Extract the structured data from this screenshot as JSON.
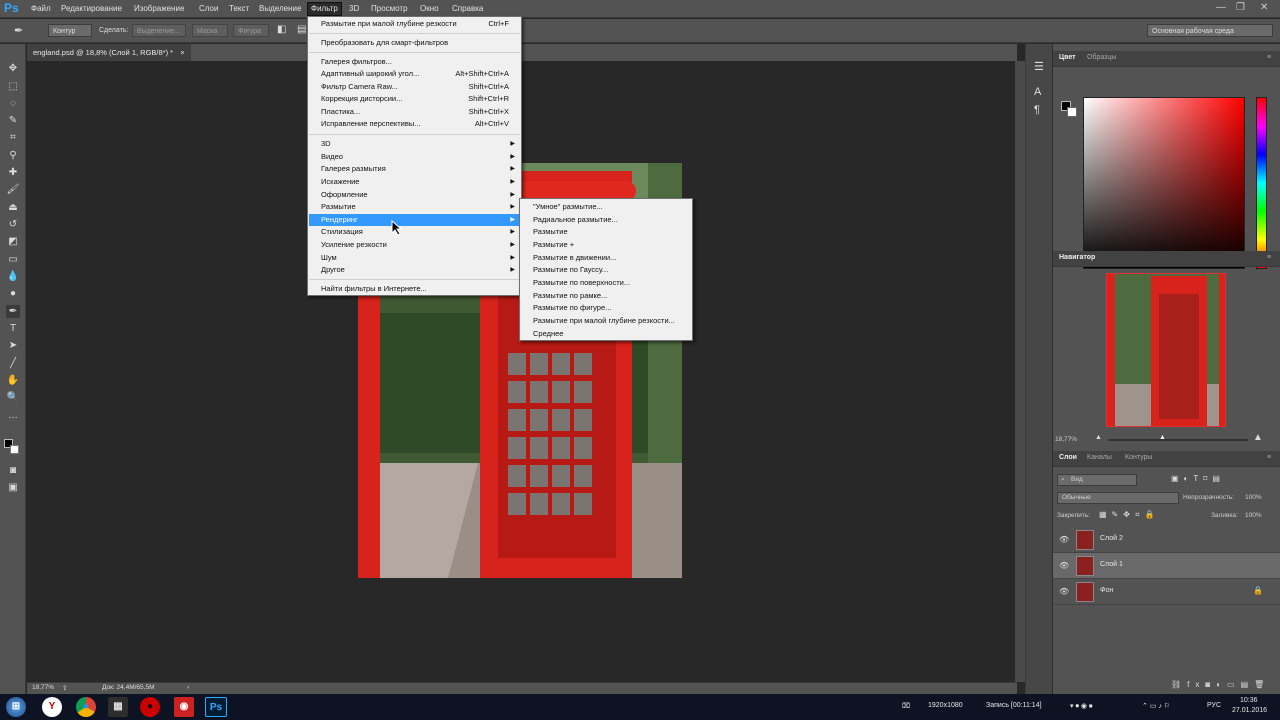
{
  "app": {
    "logo": "Ps"
  },
  "menubar": {
    "items": [
      "Файл",
      "Редактирование",
      "Изображение",
      "Слои",
      "Текст",
      "Выделение",
      "Фильтр",
      "3D",
      "Просмотр",
      "Окно",
      "Справка"
    ],
    "active": "Фильтр"
  },
  "window_controls": {
    "minimize": "—",
    "restore": "❐",
    "close": "✕"
  },
  "options_bar": {
    "tool_mode": "Контур",
    "make_label": "Сделать:",
    "selection": "Выделение...",
    "mask": "Маска",
    "shape": "Фигура",
    "workspace": "Основная рабочая среда"
  },
  "document": {
    "tab_title": "england.psd @ 18,8% (Слой 1, RGB/8*) *",
    "close": "×",
    "zoom": "18,77%",
    "doc_size": "Док: 24,4M/65,5M"
  },
  "filter_menu": {
    "items": [
      {
        "label": "Размытие при малой глубине резкости",
        "shortcut": "Ctrl+F"
      },
      {
        "label": "Преобразовать для смарт-фильтров",
        "shortcut": ""
      },
      {
        "label": "Галерея фильтров...",
        "shortcut": ""
      },
      {
        "label": "Адаптивный широкий угол...",
        "shortcut": "Alt+Shift+Ctrl+A"
      },
      {
        "label": "Фильтр Camera Raw...",
        "shortcut": "Shift+Ctrl+A"
      },
      {
        "label": "Коррекция дисторсии...",
        "shortcut": "Shift+Ctrl+R"
      },
      {
        "label": "Пластика...",
        "shortcut": "Shift+Ctrl+X"
      },
      {
        "label": "Исправление перспективы...",
        "shortcut": "Alt+Ctrl+V"
      },
      {
        "label": "3D",
        "shortcut": ""
      },
      {
        "label": "Видео",
        "shortcut": ""
      },
      {
        "label": "Галерея размытия",
        "shortcut": ""
      },
      {
        "label": "Искажение",
        "shortcut": ""
      },
      {
        "label": "Оформление",
        "shortcut": ""
      },
      {
        "label": "Размытие",
        "shortcut": ""
      },
      {
        "label": "Рендеринг",
        "shortcut": ""
      },
      {
        "label": "Стилизация",
        "shortcut": ""
      },
      {
        "label": "Усиление резкости",
        "shortcut": ""
      },
      {
        "label": "Шум",
        "shortcut": ""
      },
      {
        "label": "Другое",
        "shortcut": ""
      },
      {
        "label": "Найти фильтры в Интернете...",
        "shortcut": ""
      }
    ],
    "highlighted": "Рендеринг"
  },
  "submenu": {
    "items": [
      "\"Умное\" размытие...",
      "Радиальное размытие...",
      "Размытие",
      "Размытие +",
      "Размытие в движении...",
      "Размытие по Гауссу...",
      "Размытие по поверхности...",
      "Размытие по рамке...",
      "Размытие по фигуре...",
      "Размытие при малой глубине резкости...",
      "Среднее"
    ]
  },
  "color_panel": {
    "tabs": [
      "Цвет",
      "Образцы"
    ],
    "fg": "#000000",
    "bg": "#ffffff"
  },
  "navigator": {
    "title": "Навигатор",
    "zoom": "18,77%"
  },
  "layers_panel": {
    "tabs": [
      "Слои",
      "Каналы",
      "Контуры"
    ],
    "kind": "Вид",
    "blend_mode": "Обычные",
    "opacity_label": "Непрозрачность:",
    "opacity": "100%",
    "lock_label": "Закрепить:",
    "fill_label": "Заливка:",
    "fill": "100%",
    "layers": [
      {
        "name": "Слой 2",
        "selected": false,
        "locked": false
      },
      {
        "name": "Слой 1",
        "selected": true,
        "locked": false
      },
      {
        "name": "Фон",
        "selected": false,
        "locked": true
      }
    ]
  },
  "taskbar": {
    "resolution": "1920x1080",
    "recording": "Запись [00:11:14]",
    "language": "РУС",
    "time": "10:36",
    "date": "27.01.2016"
  },
  "colors": {
    "accent": "#3399ff",
    "ps_blue": "#31a8ff",
    "booth_red": "#d8221c"
  }
}
